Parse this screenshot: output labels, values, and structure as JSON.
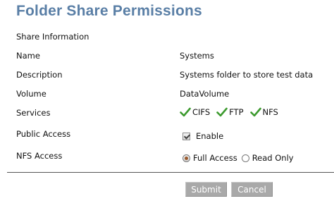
{
  "title": "Folder Share Permissions",
  "section_heading": "Share Information",
  "fields": {
    "name": {
      "label": "Name",
      "value": "Systems"
    },
    "description": {
      "label": "Description",
      "value": "Systems folder to store test data"
    },
    "volume": {
      "label": "Volume",
      "value": "DataVolume"
    },
    "services": {
      "label": "Services",
      "items": [
        "CIFS",
        "FTP",
        "NFS"
      ],
      "check_color": "#3c9a2e"
    },
    "public_access": {
      "label": "Public Access",
      "option": "Enable",
      "checked": true
    },
    "nfs_access": {
      "label": "NFS Access",
      "options": [
        "Full Access",
        "Read Only"
      ],
      "selected": "Full Access"
    }
  },
  "buttons": {
    "submit": "Submit",
    "cancel": "Cancel"
  },
  "colors": {
    "title": "#5a7fa6",
    "button_bg": "#a9a9a9"
  }
}
